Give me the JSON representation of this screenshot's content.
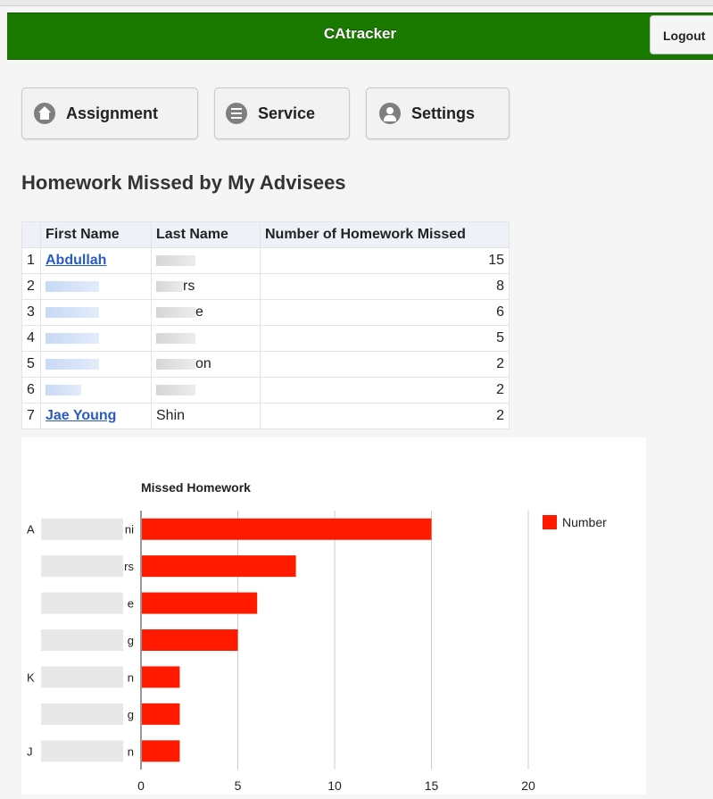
{
  "app": {
    "title": "CAtracker",
    "logout_label": "Logout"
  },
  "nav": [
    {
      "label": "Assignment",
      "icon": "home-icon"
    },
    {
      "label": "Service",
      "icon": "list-icon"
    },
    {
      "label": "Settings",
      "icon": "user-icon"
    }
  ],
  "page": {
    "title": "Homework Missed by My Advisees"
  },
  "table": {
    "columns": [
      "First Name",
      "Last Name",
      "Number of Homework Missed"
    ],
    "rows": [
      {
        "index": "1",
        "first": "Abdullah",
        "last": "",
        "missed": "15"
      },
      {
        "index": "2",
        "first": "",
        "last": "rs",
        "missed": "8"
      },
      {
        "index": "3",
        "first": "",
        "last": "e",
        "missed": "6"
      },
      {
        "index": "4",
        "first": "",
        "last": "",
        "missed": "5"
      },
      {
        "index": "5",
        "first": "",
        "last": "on",
        "missed": "2"
      },
      {
        "index": "6",
        "first": "",
        "last": "",
        "missed": "2"
      },
      {
        "index": "7",
        "first": "Jae Young",
        "last": "Shin",
        "missed": "2"
      }
    ]
  },
  "colors": {
    "header": "#1a7a00",
    "bar": "#ff1a00",
    "link": "#2a5bc4"
  },
  "chart_data": {
    "type": "bar",
    "orientation": "horizontal",
    "title": "Missed Homework",
    "categories": [
      "A…ni",
      "…rs",
      "…e",
      "…g",
      "K…n",
      "…g",
      "J…n"
    ],
    "series": [
      {
        "name": "Number",
        "values": [
          15,
          8,
          6,
          5,
          2,
          2,
          2
        ]
      }
    ],
    "xlim": [
      0,
      20
    ],
    "xticks": [
      0,
      5,
      10,
      15,
      20
    ],
    "grid": true,
    "legend": "top-right"
  }
}
